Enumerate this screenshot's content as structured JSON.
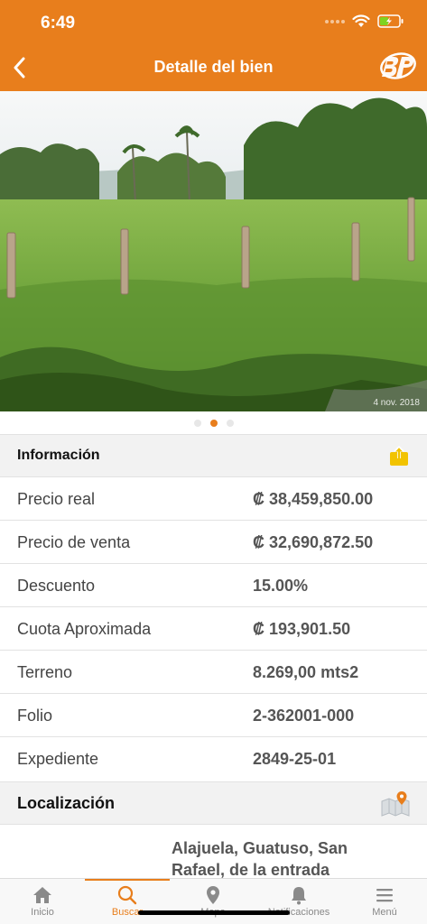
{
  "status_bar": {
    "time": "6:49"
  },
  "header": {
    "title": "Detalle del bien"
  },
  "gallery": {
    "photo_date": "4 nov. 2018",
    "page_count": 3,
    "active_index": 1
  },
  "info_section": {
    "title": "Información",
    "rows": [
      {
        "label": "Precio real",
        "value": "₡ 38,459,850.00"
      },
      {
        "label": "Precio de venta",
        "value": "₡ 32,690,872.50"
      },
      {
        "label": "Descuento",
        "value": "15.00%"
      },
      {
        "label": "Cuota Aproximada",
        "value": "₡ 193,901.50"
      },
      {
        "label": "Terreno",
        "value": "8.269,00 mts2"
      },
      {
        "label": "Folio",
        "value": "2-362001-000"
      },
      {
        "label": "Expediente",
        "value": "2849-25-01"
      }
    ]
  },
  "location_section": {
    "title": "Localización",
    "address": "Alajuela, Guatuso, San Rafael, de la entrada"
  },
  "tab_bar": {
    "items": [
      {
        "label": "Inicio",
        "icon": "home-icon"
      },
      {
        "label": "Buscar",
        "icon": "search-icon",
        "active": true
      },
      {
        "label": "Mapa",
        "icon": "map-pin-icon"
      },
      {
        "label": "Notificaciones",
        "icon": "bell-icon"
      },
      {
        "label": "Menú",
        "icon": "menu-icon"
      }
    ]
  },
  "colors": {
    "brand": "#e87e1c",
    "section_bg": "#f2f2f2",
    "share_icon": "#f2c300"
  }
}
